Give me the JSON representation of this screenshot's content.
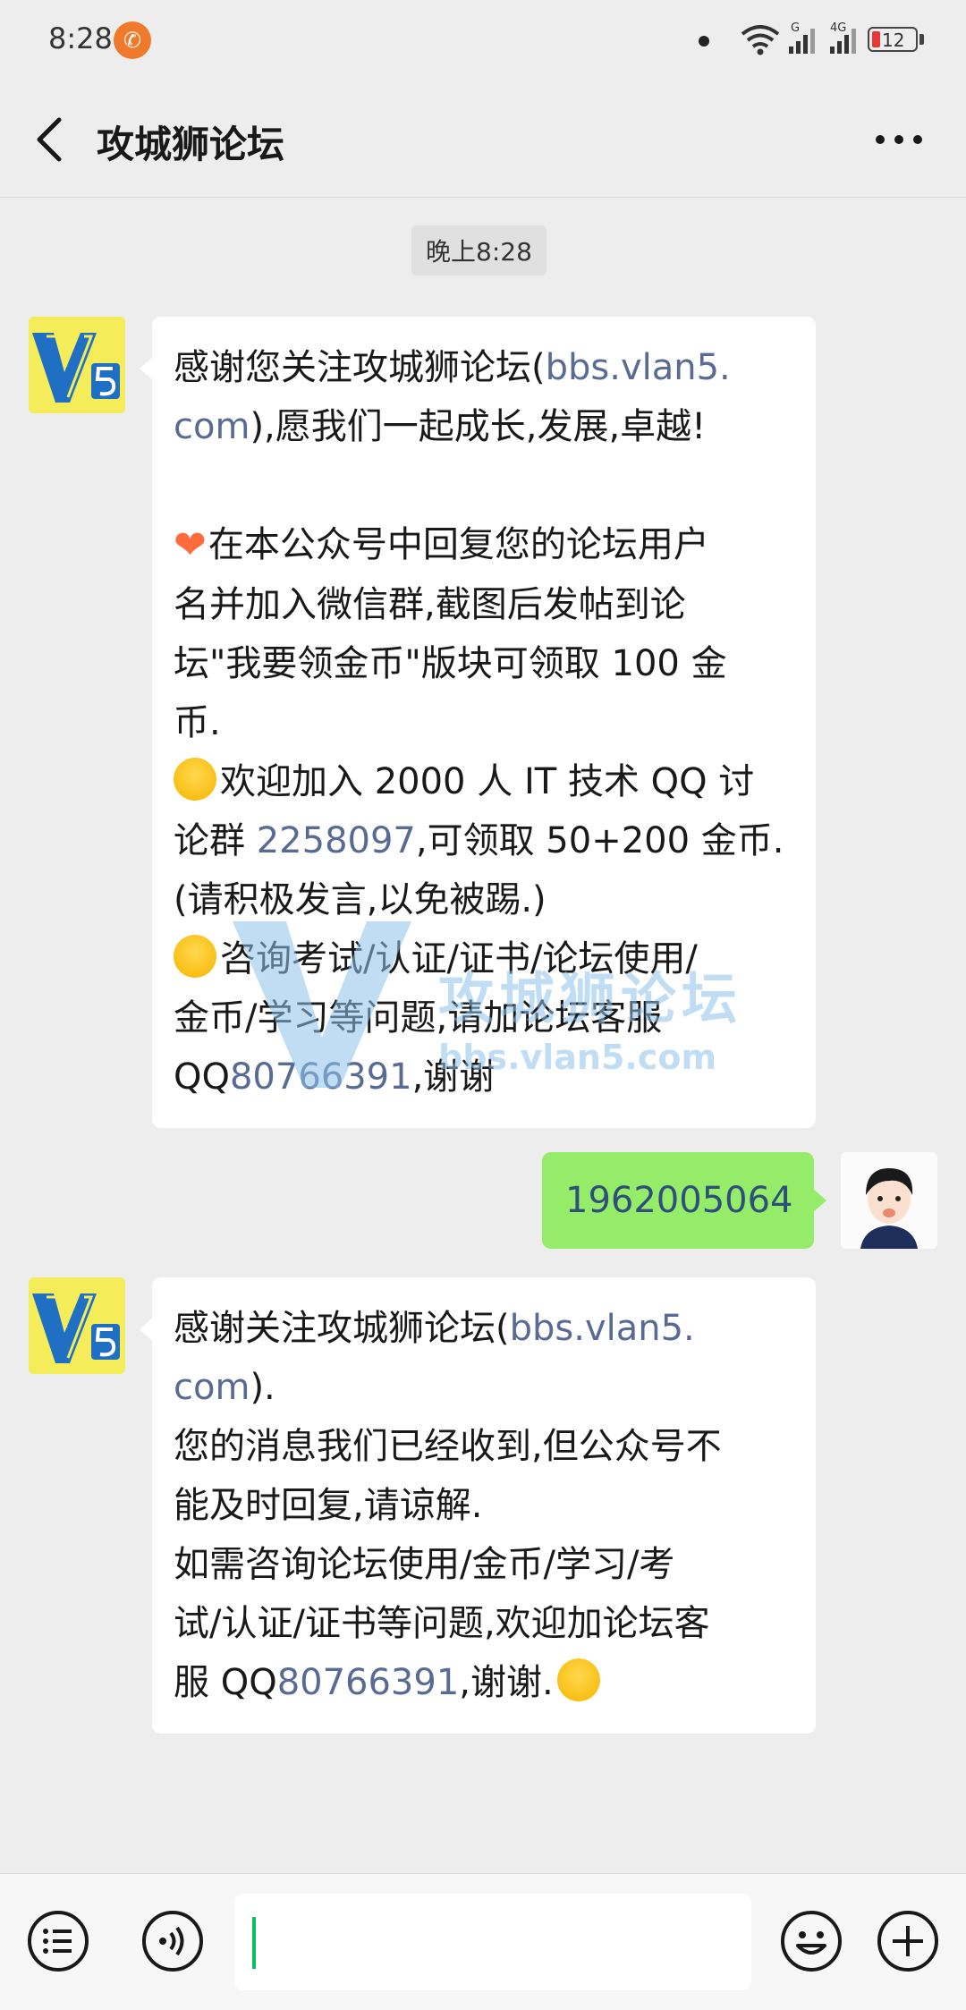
{
  "status_bar": {
    "time": "8:28",
    "signal1_label": "G",
    "signal2_label": "4G",
    "battery": "12",
    "battery_level_percent": 12
  },
  "header": {
    "title": "攻城狮论坛"
  },
  "chat": {
    "time_label": "晚上8:28",
    "message1": {
      "line1a": "感谢您关注攻城狮论坛(",
      "line1b": "bbs.vlan5.",
      "line2a": "com",
      "line2b": "),愿我们一起成长,发展,卓越!",
      "line3": "在本公众号中回复您的论坛用户",
      "line4": "名并加入微信群,截图后发帖到论",
      "line5": "坛\"我要领金币\"版块可领取 100 金",
      "line6": "币.",
      "line7": "欢迎加入 2000 人 IT 技术 QQ 讨",
      "line8a": "论群 ",
      "line8b": "2258097",
      "line8c": ",可领取 50+200 金币.",
      "line9": "(请积极发言,以免被踢.)",
      "line10": "咨询考试/认证/证书/论坛使用/",
      "line11": "金币/学习等问题,请加论坛客服",
      "line12a": "QQ",
      "line12b": "80766391",
      "line12c": ",谢谢"
    },
    "sent_message": "1962005064",
    "message2": {
      "line1a": "感谢关注攻城狮论坛(",
      "line1b": "bbs.vlan5.",
      "line2a": "com",
      "line2b": ").",
      "line3": "您的消息我们已经收到,但公众号不",
      "line4": "能及时回复,请谅解.",
      "line5": "如需咨询论坛使用/金币/学习/考",
      "line6": "试/认证/证书等问题,欢迎加论坛客",
      "line7a": "服 QQ",
      "line7b": "80766391",
      "line7c": ",谢谢."
    },
    "watermark": {
      "title": "攻城狮论坛",
      "url": "bbs.vlan5.com"
    }
  },
  "colors": {
    "background": "#ededed",
    "bubble_in": "#ffffff",
    "bubble_out": "#95ec69",
    "link": "#576b95",
    "caret": "#07c160"
  },
  "icons": {
    "back": "chevron-left-icon",
    "more": "more-dots-icon",
    "menu": "list-menu-icon",
    "voice": "voice-icon",
    "emoji": "emoji-icon",
    "add": "plus-icon"
  }
}
